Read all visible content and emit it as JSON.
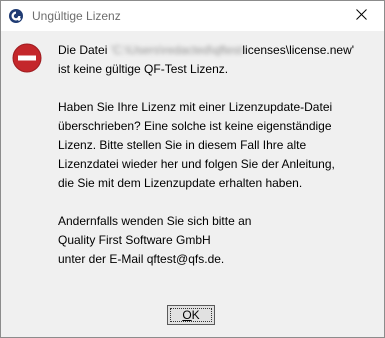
{
  "window": {
    "title": "Ungültige Lizenz",
    "app_icon": "qftest-logo-icon",
    "close_icon": "close-icon"
  },
  "message": {
    "icon": "error-icon",
    "paragraph1": {
      "prefix": "Die Datei ",
      "redacted_path": "'C:\\Users\\redacted\\qftest",
      "suffix": "licenses\\license.new'",
      "line2": "ist keine gültige QF-Test Lizenz."
    },
    "paragraph2": [
      "Haben Sie Ihre Lizenz mit einer Lizenzupdate-Datei",
      "überschrieben? Eine solche ist keine eigenständige",
      "Lizenz. Bitte stellen Sie in diesem Fall Ihre alte",
      "Lizenzdatei wieder her und folgen Sie der Anleitung,",
      "die Sie mit dem Lizenzupdate erhalten haben."
    ],
    "paragraph3": [
      "Andernfalls wenden Sie sich bitte an",
      "Quality First Software GmbH",
      "unter der E-Mail qftest@qfs.de."
    ]
  },
  "buttons": {
    "ok_mnemonic": "O",
    "ok_rest": "K"
  },
  "colors": {
    "error_red": "#c4272b",
    "dialog_bg": "#f0f0f0",
    "titlebar_bg": "#ffffff",
    "logo_blue": "#1f3b73"
  }
}
